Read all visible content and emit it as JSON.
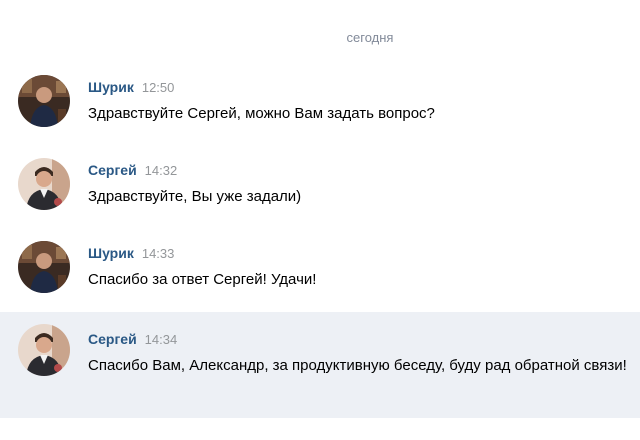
{
  "date_divider": "сегодня",
  "colors": {
    "author_link": "#2a5885",
    "time": "#939699",
    "highlight_bg": "#edf0f5",
    "divider_text": "#828a99"
  },
  "messages": [
    {
      "author": "Шурик",
      "time": "12:50",
      "text": "Здравствуйте Сергей, можно Вам задать вопрос?",
      "avatar": "avatar-shurik"
    },
    {
      "author": "Сергей",
      "time": "14:32",
      "text": "Здравствуйте, Вы уже задали)",
      "avatar": "avatar-sergey"
    },
    {
      "author": "Шурик",
      "time": "14:33",
      "text": "Спасибо за ответ Сергей! Удачи!",
      "avatar": "avatar-shurik"
    },
    {
      "author": "Сергей",
      "time": "14:34",
      "text": "Спасибо Вам, Александр, за продуктивную беседу, буду рад обратной связи!",
      "avatar": "avatar-sergey",
      "highlighted": true
    }
  ]
}
